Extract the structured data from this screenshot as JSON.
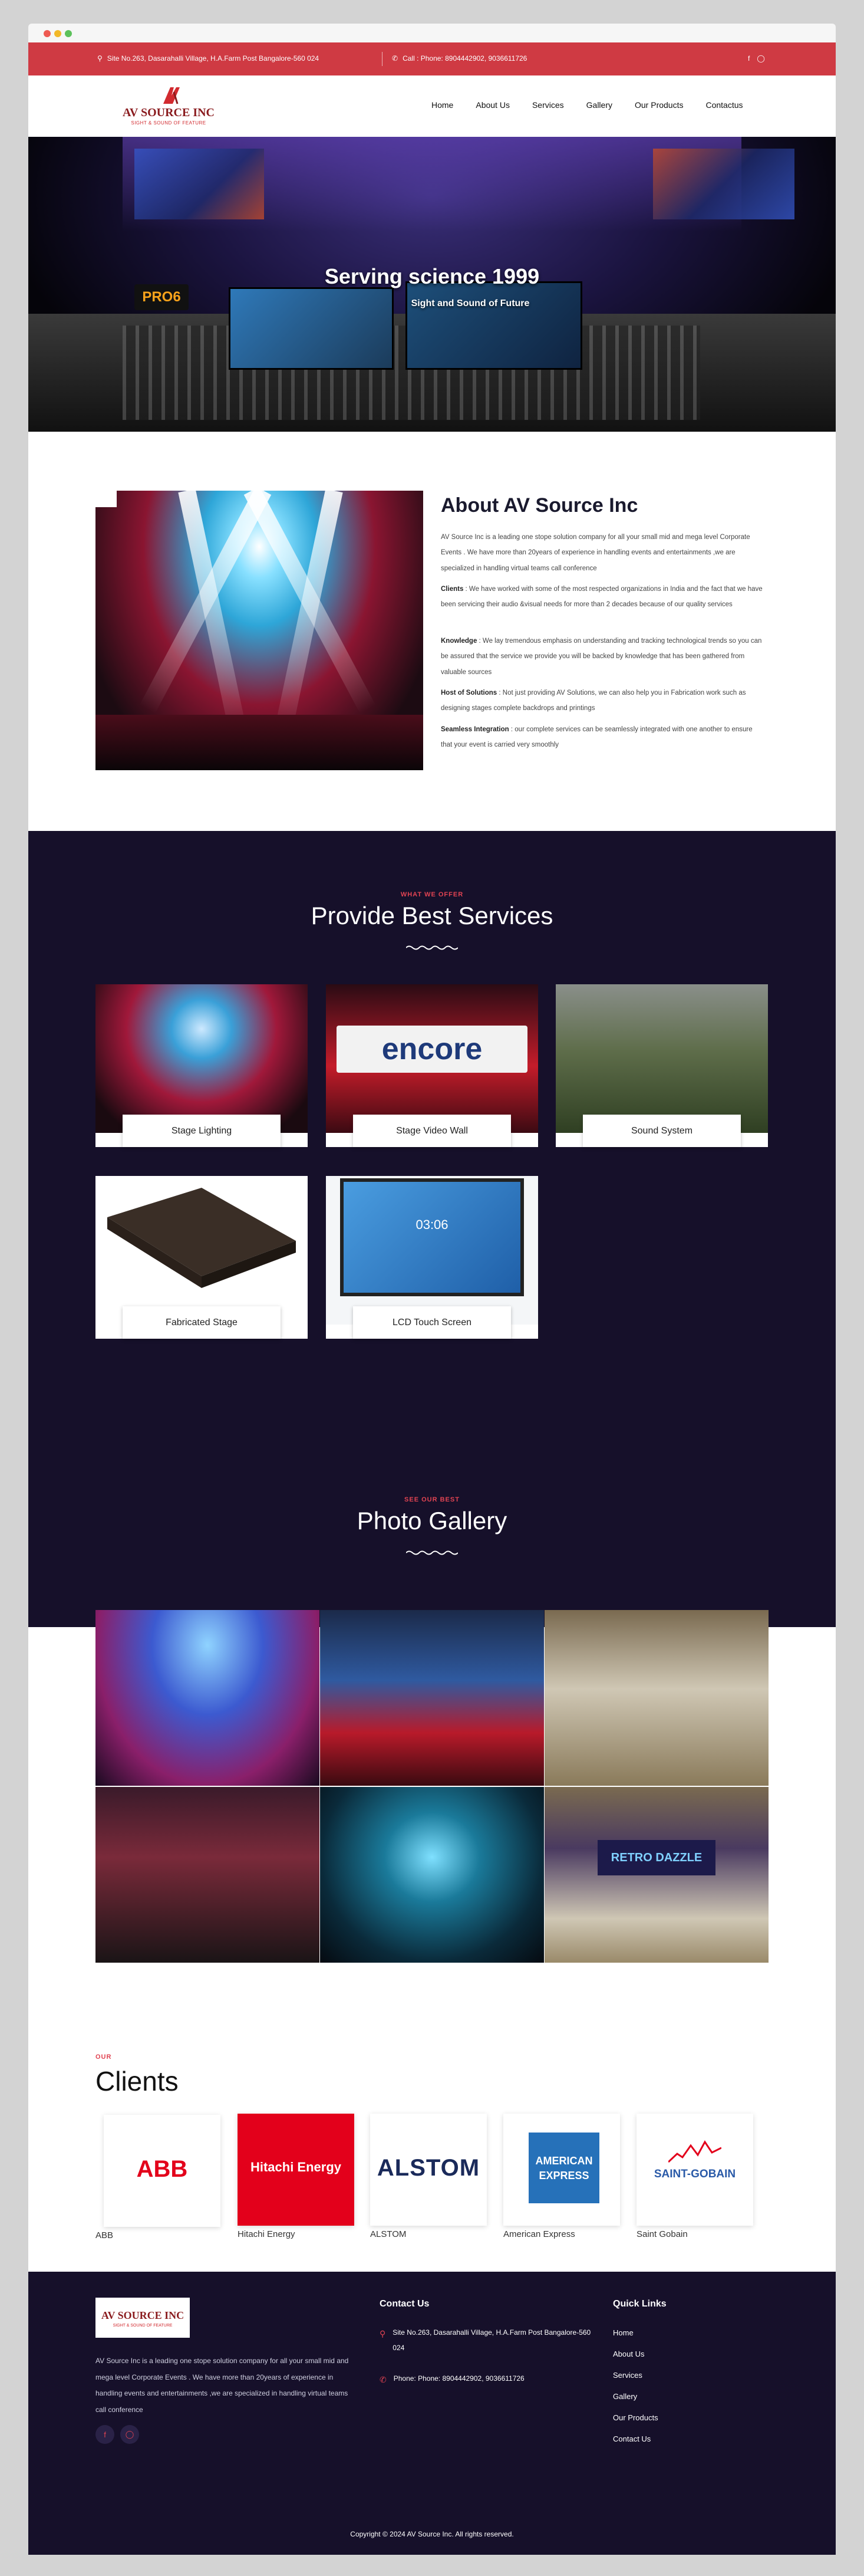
{
  "topbar": {
    "address": "Site No.263, Dasarahalli Village, H.A.Farm Post Bangalore-560 024",
    "phone": "Call : Phone: 8904442902, 9036611726"
  },
  "brand": {
    "name": "AV SOURCE INC",
    "tagline": "SIGHT & SOUND OF FEATURE",
    "color": "#cf3a43"
  },
  "nav": [
    "Home",
    "About Us",
    "Services",
    "Gallery",
    "Our Products",
    "Contactus"
  ],
  "hero": {
    "title": "Serving science 1999",
    "subtitle": "Sight and Sound of Future",
    "badge": "PRO6"
  },
  "about": {
    "title": "About AV Source Inc",
    "paragraphs": [
      {
        "lead": "",
        "text": "AV Source Inc is a leading one stope solution  company for all your  small  mid and mega level Corporate Events . We have more than 20years of experience in handling events and entertainments ,we are specialized in handling virtual  teams call conference"
      },
      {
        "lead": "Clients",
        "text": ":  We have worked with some of the most respected organizations in India and the fact that we have been servicing their audio &visual needs for more than 2 decades because of our quality services"
      },
      {
        "lead": "Knowledge",
        "text": ": We lay tremendous emphasis on understanding and tracking technological trends so you can be assured that the service we provide you will be backed by knowledge that has been gathered from valuable sources"
      },
      {
        "lead": "Host of Solutions",
        "text": ": Not just providing AV Solutions, we can also help you in Fabrication work such as designing stages  complete backdrops and printings"
      },
      {
        "lead": "Seamless Integration",
        "text": ": our complete services can be seamlessly integrated with one another to ensure that your event is carried  very smoothly"
      }
    ]
  },
  "services": {
    "eyebrow": "WHAT WE OFFER",
    "title": "Provide Best Services",
    "items": [
      {
        "label": "Stage Lighting"
      },
      {
        "label": "Stage Video Wall",
        "screen_text": "encore"
      },
      {
        "label": "Sound System"
      },
      {
        "label": "Fabricated Stage"
      },
      {
        "label": "LCD Touch Screen",
        "screen_text": "03:06"
      }
    ]
  },
  "gallery": {
    "eyebrow": "SEE OUR BEST",
    "title": "Photo Gallery",
    "banner_text": "RETRO DAZZLE"
  },
  "clients": {
    "eyebrow": "OUR",
    "title": "Clients",
    "items": [
      {
        "name": "ABB",
        "logo_text": "ABB"
      },
      {
        "name": "Hitachi Energy",
        "logo_text": "Hitachi Energy"
      },
      {
        "name": "ALSTOM",
        "logo_text": "ALSTOM"
      },
      {
        "name": "American Express",
        "logo_text_1": "AMERICAN",
        "logo_text_2": "EXPRESS"
      },
      {
        "name": "Saint Gobain",
        "logo_text": "SAINT-GOBAIN"
      }
    ]
  },
  "footer": {
    "about": "AV Source Inc is a leading one stope solution  company for all your  small  mid and mega level Corporate Events . We have more than 20years of experience in handling events and entertainments ,we are specialized in handling virtual  teams call conference",
    "contact_heading": "Contact Us",
    "contact_address": "Site No.263, Dasarahalli Village, H.A.Farm Post Bangalore-560 024",
    "contact_phone": "Phone: Phone: 8904442902, 9036611726",
    "links_heading": "Quick Links",
    "links": [
      "Home",
      "About Us",
      "Services",
      "Gallery",
      "Our Products",
      "Contact Us"
    ],
    "copyright": "Copyright © 2024 AV Source Inc. All rights reserved."
  }
}
